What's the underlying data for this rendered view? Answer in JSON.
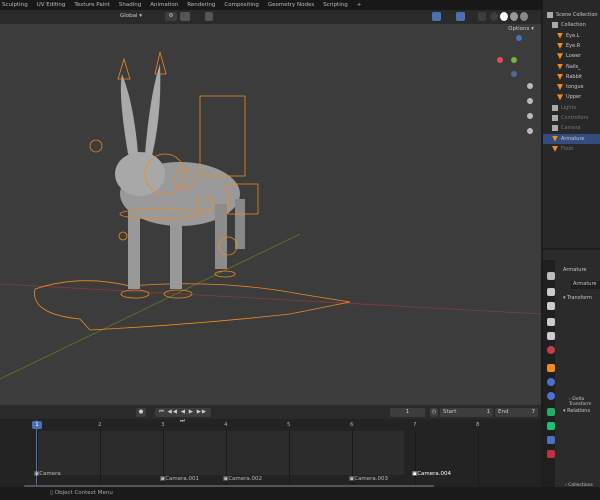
{
  "workspaces": [
    "Sculpting",
    "UV Editing",
    "Texture Paint",
    "Shading",
    "Animation",
    "Rendering",
    "Compositing",
    "Geometry Nodes",
    "Scripting",
    "+"
  ],
  "header": {
    "transform_orientation": "Global",
    "options_label": "Options"
  },
  "outliner": {
    "items": [
      {
        "label": "Scene Collection",
        "type": "collection",
        "depth": 0
      },
      {
        "label": "Collection",
        "type": "collection",
        "depth": 1
      },
      {
        "label": "Eye.L",
        "type": "object",
        "depth": 2
      },
      {
        "label": "Eye.R",
        "type": "object",
        "depth": 2
      },
      {
        "label": "Lower",
        "type": "object",
        "depth": 2
      },
      {
        "label": "Nails_",
        "type": "object",
        "depth": 2
      },
      {
        "label": "Rabbit",
        "type": "object",
        "depth": 2
      },
      {
        "label": "tongue",
        "type": "object",
        "depth": 2
      },
      {
        "label": "Upper",
        "type": "object",
        "depth": 2
      },
      {
        "label": "Lights",
        "type": "collection",
        "depth": 1,
        "dim": true
      },
      {
        "label": "Controllers",
        "type": "collection",
        "depth": 1,
        "dim": true
      },
      {
        "label": "Camera",
        "type": "collection",
        "depth": 1,
        "dim": true
      },
      {
        "label": "Armature",
        "type": "armature",
        "depth": 1,
        "selected": true
      },
      {
        "label": "Floor",
        "type": "object",
        "depth": 1,
        "dim": true
      }
    ]
  },
  "properties": {
    "object_name": "Armature",
    "data_name": "Armature",
    "panels": {
      "transform": "Transform",
      "delta": "Delta Transform",
      "relations": "Relations",
      "collections": "Collections"
    }
  },
  "timeline": {
    "current_frame": "1",
    "start_label": "Start",
    "start": "1",
    "end_label": "End",
    "end": "7",
    "ticks": [
      "1",
      "2",
      "3",
      "4",
      "5",
      "6",
      "7",
      "8"
    ],
    "markers": [
      "Camera",
      "Camera.001",
      "Camera.002",
      "Camera.003",
      "Camera.004"
    ]
  },
  "status": {
    "hint": "Object Context Menu"
  },
  "colors": {
    "accent": "#4772b3",
    "armature": "#f28a1f",
    "selected_row": "#334d80"
  }
}
